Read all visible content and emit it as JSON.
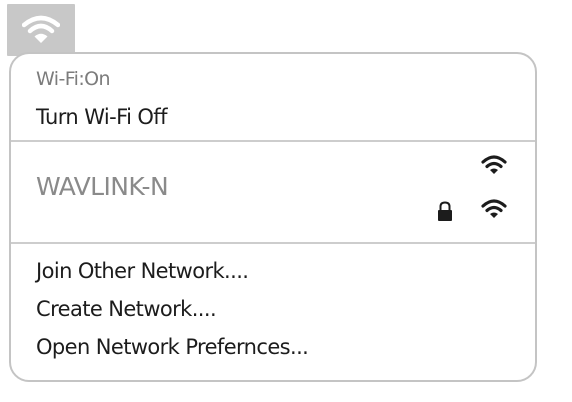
{
  "menubar": {
    "wifi_icon": "wifi-icon"
  },
  "menu": {
    "status_text": "Wi-Fi:On",
    "toggle_label": "Turn Wi-Fi Off",
    "networks": [
      {
        "name": "WAVLINK-N",
        "icons": [
          "wifi-signal-icon",
          "lock-icon",
          "wifi-signal-icon"
        ]
      }
    ],
    "join_other_label": "Join Other Network....",
    "create_network_label": "Create Network....",
    "preferences_label": "Open Network Prefernces..."
  },
  "colors": {
    "tray_background": "#c8c8c8",
    "menu_border": "#c4c4c4",
    "separator": "#cdcdcd",
    "muted_text": "#7c7c7c",
    "text": "#1c1c1c"
  }
}
